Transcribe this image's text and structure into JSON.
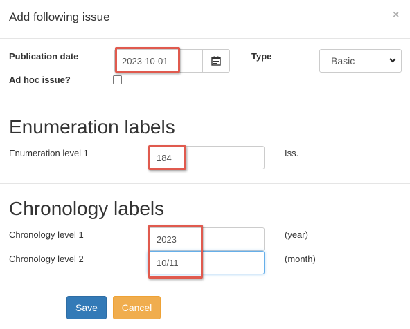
{
  "modal": {
    "title": "Add following issue",
    "close_label": "×"
  },
  "publication": {
    "date_label": "Publication date",
    "date_value": "2023-10-01",
    "type_label": "Type",
    "type_value": "Basic",
    "adhoc_label": "Ad hoc issue?",
    "adhoc_checked": false
  },
  "enumeration": {
    "heading": "Enumeration labels",
    "level1_label": "Enumeration level 1",
    "level1_value": "184",
    "level1_suffix": "Iss."
  },
  "chronology": {
    "heading": "Chronology labels",
    "level1_label": "Chronology level 1",
    "level1_value": "2023",
    "level1_suffix": "(year)",
    "level2_label": "Chronology level 2",
    "level2_value": "10/11",
    "level2_suffix": "(month)"
  },
  "footer": {
    "save_label": "Save",
    "cancel_label": "Cancel"
  },
  "colors": {
    "highlight": "#e05a4e",
    "save": "#337ab7",
    "cancel": "#f0ad4e"
  },
  "icons": {
    "calendar": "calendar-icon",
    "select": "chevron-down-icon",
    "close": "close-icon"
  }
}
